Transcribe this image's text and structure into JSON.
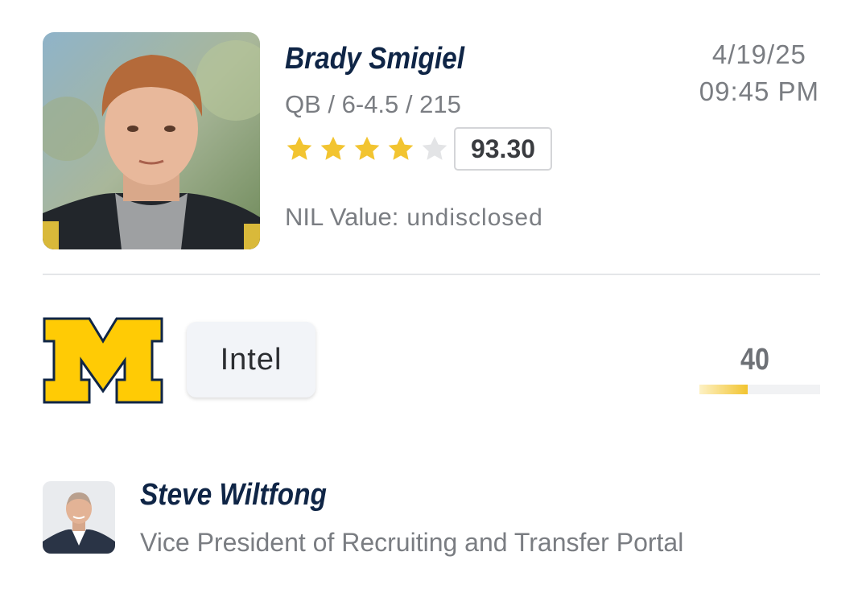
{
  "player": {
    "name": "Brady Smigiel",
    "meta": "QB / 6-4.5 / 215",
    "stars": 4,
    "max_stars": 5,
    "rating": "93.30",
    "nil_label": "NIL Value:",
    "nil_value": "undisclosed"
  },
  "post": {
    "date": "4/19/25",
    "time": "09:45 PM"
  },
  "prediction": {
    "team_logo": "michigan-block-m-logo",
    "pill_label": "Intel",
    "score": "40",
    "score_fraction": 0.4
  },
  "author": {
    "name": "Steve Wiltfong",
    "title": "Vice President of Recruiting and Transfer Portal"
  },
  "colors": {
    "navy": "#0f2546",
    "gold": "#f2c430",
    "maize": "#ffcb05",
    "gray_text": "#7a7d82"
  }
}
